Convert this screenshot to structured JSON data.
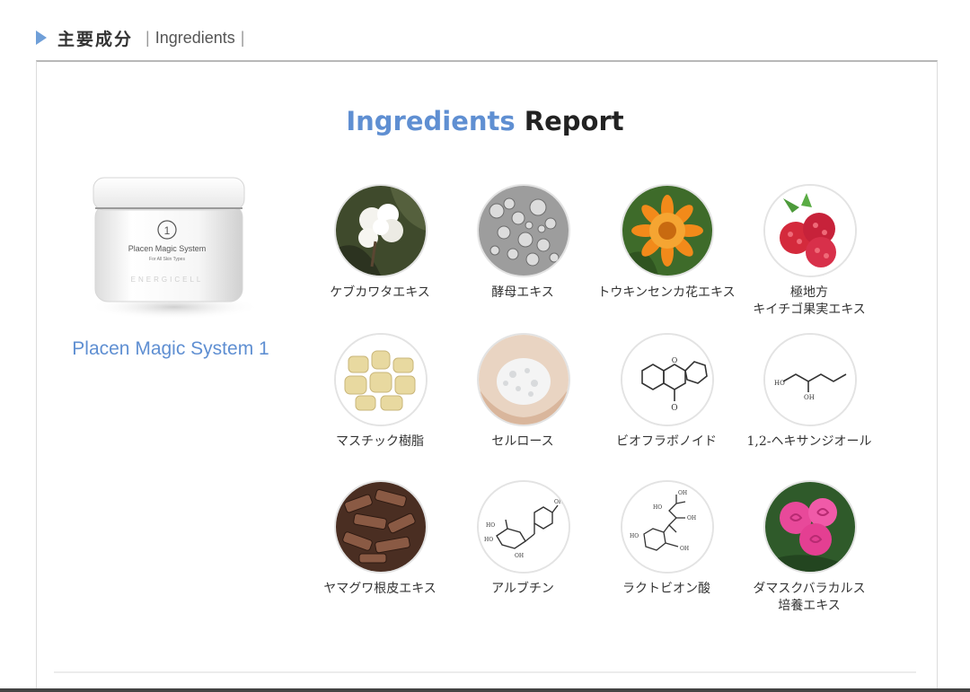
{
  "header": {
    "title": "主要成分",
    "separator": "|",
    "subtitle": "Ingredients",
    "separator_end": "|"
  },
  "report": {
    "title_accent": "Ingredients",
    "title_rest": "Report"
  },
  "product": {
    "name": "Placen Magic System 1",
    "jar_number": "1",
    "jar_label": "Placen Magic System",
    "jar_sublabel": "For All Skin Types",
    "jar_brand": "ENERGICELL"
  },
  "ingredients": [
    {
      "line1": "ケブカワタエキス",
      "line2": "",
      "icon": "cotton-image"
    },
    {
      "line1": "酵母エキス",
      "line2": "",
      "icon": "yeast-image"
    },
    {
      "line1": "トウキンセンカ花エキス",
      "line2": "",
      "icon": "calendula-image"
    },
    {
      "line1": "極地方",
      "line2": "キイチゴ果実エキス",
      "icon": "raspberry-image"
    },
    {
      "line1": "マスチック樹脂",
      "line2": "",
      "icon": "mastic-resin-image"
    },
    {
      "line1": "セルロース",
      "line2": "",
      "icon": "cellulose-image"
    },
    {
      "line1": "ビオフラボノイド",
      "line2": "",
      "icon": "bioflavonoid-structure-icon"
    },
    {
      "line1": "1,2-ヘキサンジオール",
      "line2": "",
      "icon": "hexanediol-structure-icon"
    },
    {
      "line1": "ヤマグワ根皮エキス",
      "line2": "",
      "icon": "mulberry-bark-image"
    },
    {
      "line1": "アルブチン",
      "line2": "",
      "icon": "arbutin-structure-icon"
    },
    {
      "line1": "ラクトビオン酸",
      "line2": "",
      "icon": "lactobionic-acid-structure-icon"
    },
    {
      "line1": "ダマスクバラカルス",
      "line2": "培養エキス",
      "icon": "damask-rose-image"
    }
  ],
  "chem_labels": {
    "ho": "HO",
    "oh": "OH",
    "o": "O"
  },
  "colors": {
    "accent": "#5f8fd2",
    "triangle": "#6f9fd8",
    "text": "#333333",
    "border": "#dcdcdc"
  }
}
